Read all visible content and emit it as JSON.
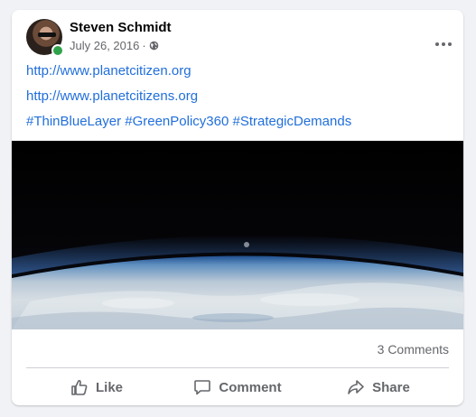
{
  "post": {
    "author": "Steven Schmidt",
    "date": "July 26, 2016",
    "separator": "·",
    "privacy_icon": "globe-icon",
    "links": [
      "http://www.planetcitizen.org",
      "http://www.planetcitizens.org"
    ],
    "hashtags": "#ThinBlueLayer #GreenPolicy360 #StrategicDemands",
    "image_description_icon": "earth-horizon-image"
  },
  "stats": {
    "comments": "3 Comments"
  },
  "actions": {
    "like": "Like",
    "comment": "Comment",
    "share": "Share"
  },
  "colors": {
    "link": "#216fdb",
    "online": "#31a24c",
    "muted": "#65676b"
  }
}
